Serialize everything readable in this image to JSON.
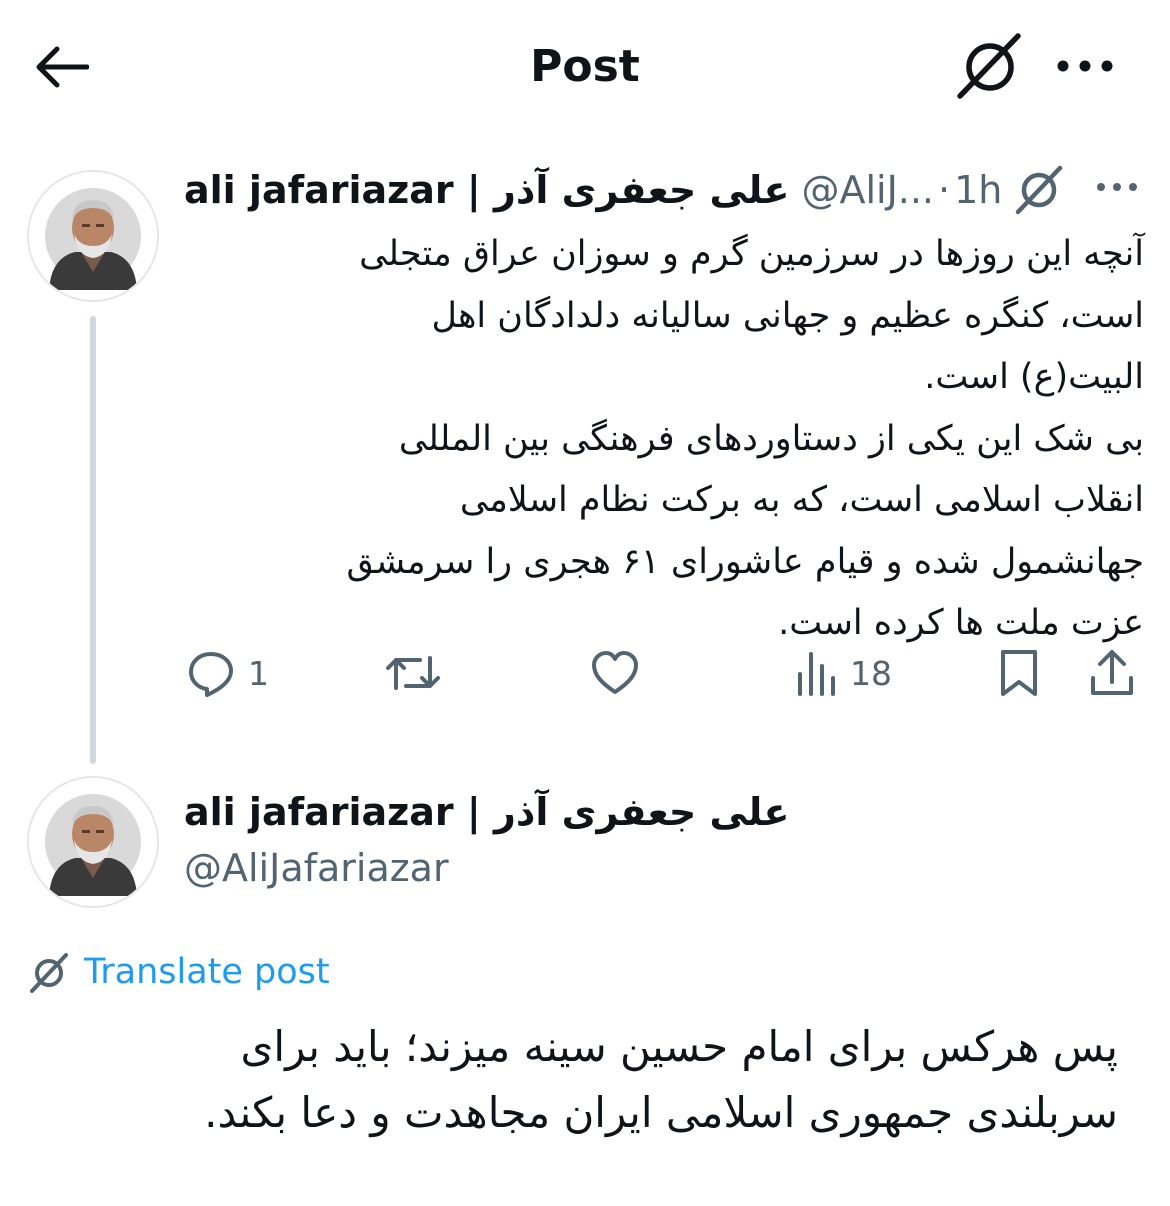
{
  "header": {
    "title": "Post"
  },
  "icons": {
    "back": "arrow-left-icon",
    "translate": "translate-icon",
    "more": "more-horizontal-icon",
    "reply": "reply-icon",
    "repost": "repost-icon",
    "like": "heart-icon",
    "views": "views-icon",
    "bookmark": "bookmark-icon",
    "share": "share-icon"
  },
  "colors": {
    "link": "#1d9bf0",
    "muted": "#536471",
    "text": "#0f1419",
    "thread_line": "#cfd9de"
  },
  "tweet1": {
    "display_name": "ali jafariazar | علی جعفری آذر",
    "handle_truncated": "@AliJ...",
    "separator": "·",
    "time": "1h",
    "body_lines": [
      "آنچه این روزها در سرزمین گرم و سوزان عراق متجلی",
      "است، کنگره عظیم و جهانی سالیانه دلدادگان اهل",
      "البیت(ع) است.",
      "بی شک این یکی از دستاوردهای فرهنگی بین المللی",
      "انقلاب اسلامی است، که به برکت نظام اسلامی",
      "جهانشمول شده و قیام عاشورای ۶۱ هجری را سرمشق",
      "عزت ملت ها کرده است."
    ],
    "actions": {
      "reply_count": "1",
      "repost_count": "",
      "like_count": "",
      "views_count": "18"
    }
  },
  "tweet2": {
    "display_name": "ali jafariazar | علی جعفری آذر",
    "handle": "@AliJafariazar",
    "translate_label": "Translate post",
    "body_lines": [
      "پس هرکس برای امام حسین سینه میزند؛ باید برای",
      "سربلندی جمهوری اسلامی ایران مجاهدت و دعا بکند."
    ]
  }
}
